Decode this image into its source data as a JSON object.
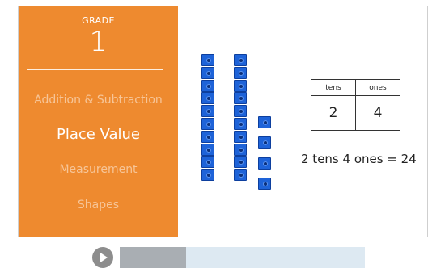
{
  "sidebar": {
    "grade_label": "GRADE",
    "grade_number": "1",
    "items": [
      {
        "label": "Addition & Subtraction",
        "active": false
      },
      {
        "label": "Place Value",
        "active": true
      },
      {
        "label": "Measurement",
        "active": false
      },
      {
        "label": "Shapes",
        "active": false
      }
    ]
  },
  "lesson": {
    "blocks": {
      "tens_rods": 2,
      "ones_cubes": 4,
      "color": "#1e63d8"
    },
    "table": {
      "headers": [
        "tens",
        "ones"
      ],
      "values": [
        "2",
        "4"
      ]
    },
    "equation": "2 tens 4 ones = 24"
  },
  "player": {
    "progress": 0.27,
    "play_icon": "play-icon"
  },
  "colors": {
    "sidebar": "#ee8a2f",
    "track": "#dde9f2",
    "track_fill": "#a9aeb3"
  }
}
